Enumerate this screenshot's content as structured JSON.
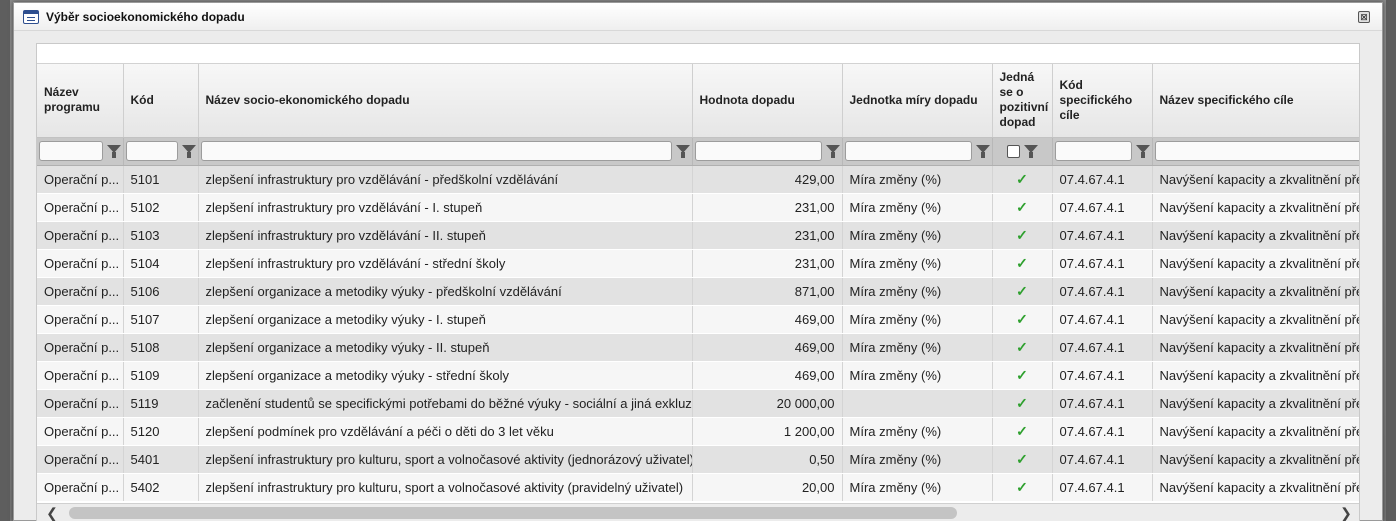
{
  "dialog": {
    "title": "Výběr socioekonomického dopadu",
    "close_glyph": "⊠"
  },
  "table": {
    "columns": [
      {
        "label": "Název programu"
      },
      {
        "label": "Kód"
      },
      {
        "label": "Název socio-ekonomického dopadu"
      },
      {
        "label": "Hodnota dopadu"
      },
      {
        "label": "Jednotka míry dopadu"
      },
      {
        "label": "Jedná se o pozitivní dopad"
      },
      {
        "label": "Kód specifického cíle"
      },
      {
        "label": "Název specifického cíle"
      }
    ],
    "rows": [
      {
        "program": "Operační p...",
        "kod": "5101",
        "nazev": "zlepšení infrastruktury pro vzdělávání - předškolní vzdělávání",
        "hodnota": "429,00",
        "jednotka": "Míra změny (%)",
        "pozitivni": true,
        "kod_cile": "07.4.67.4.1",
        "nazev_cile": "Navýšení kapacity a zkvalitnění předš"
      },
      {
        "program": "Operační p...",
        "kod": "5102",
        "nazev": "zlepšení infrastruktury pro vzdělávání - I. stupeň",
        "hodnota": "231,00",
        "jednotka": "Míra změny (%)",
        "pozitivni": true,
        "kod_cile": "07.4.67.4.1",
        "nazev_cile": "Navýšení kapacity a zkvalitnění předš"
      },
      {
        "program": "Operační p...",
        "kod": "5103",
        "nazev": "zlepšení infrastruktury pro vzdělávání - II. stupeň",
        "hodnota": "231,00",
        "jednotka": "Míra změny (%)",
        "pozitivni": true,
        "kod_cile": "07.4.67.4.1",
        "nazev_cile": "Navýšení kapacity a zkvalitnění předš"
      },
      {
        "program": "Operační p...",
        "kod": "5104",
        "nazev": "zlepšení infrastruktury pro vzdělávání - střední školy",
        "hodnota": "231,00",
        "jednotka": "Míra změny (%)",
        "pozitivni": true,
        "kod_cile": "07.4.67.4.1",
        "nazev_cile": "Navýšení kapacity a zkvalitnění předš"
      },
      {
        "program": "Operační p...",
        "kod": "5106",
        "nazev": "zlepšení organizace a metodiky výuky - předškolní vzdělávání",
        "hodnota": "871,00",
        "jednotka": "Míra změny (%)",
        "pozitivni": true,
        "kod_cile": "07.4.67.4.1",
        "nazev_cile": "Navýšení kapacity a zkvalitnění předš"
      },
      {
        "program": "Operační p...",
        "kod": "5107",
        "nazev": "zlepšení organizace a metodiky výuky - I. stupeň",
        "hodnota": "469,00",
        "jednotka": "Míra změny (%)",
        "pozitivni": true,
        "kod_cile": "07.4.67.4.1",
        "nazev_cile": "Navýšení kapacity a zkvalitnění předš"
      },
      {
        "program": "Operační p...",
        "kod": "5108",
        "nazev": "zlepšení organizace a metodiky výuky - II. stupeň",
        "hodnota": "469,00",
        "jednotka": "Míra změny (%)",
        "pozitivni": true,
        "kod_cile": "07.4.67.4.1",
        "nazev_cile": "Navýšení kapacity a zkvalitnění předš"
      },
      {
        "program": "Operační p...",
        "kod": "5109",
        "nazev": "zlepšení organizace a metodiky výuky - střední školy",
        "hodnota": "469,00",
        "jednotka": "Míra změny (%)",
        "pozitivni": true,
        "kod_cile": "07.4.67.4.1",
        "nazev_cile": "Navýšení kapacity a zkvalitnění předš"
      },
      {
        "program": "Operační p...",
        "kod": "5119",
        "nazev": "začlenění studentů se specifickými potřebami do běžné výuky - sociální a jiná exkluze",
        "hodnota": "20 000,00",
        "jednotka": "",
        "pozitivni": true,
        "kod_cile": "07.4.67.4.1",
        "nazev_cile": "Navýšení kapacity a zkvalitnění předš"
      },
      {
        "program": "Operační p...",
        "kod": "5120",
        "nazev": "zlepšení podmínek pro vzdělávání a péči o děti do 3 let věku",
        "hodnota": "1 200,00",
        "jednotka": "Míra změny (%)",
        "pozitivni": true,
        "kod_cile": "07.4.67.4.1",
        "nazev_cile": "Navýšení kapacity a zkvalitnění předš"
      },
      {
        "program": "Operační p...",
        "kod": "5401",
        "nazev": "zlepšení infrastruktury pro kulturu, sport a volnočasové aktivity (jednorázový uživatel)",
        "hodnota": "0,50",
        "jednotka": "Míra změny (%)",
        "pozitivni": true,
        "kod_cile": "07.4.67.4.1",
        "nazev_cile": "Navýšení kapacity a zkvalitnění předš"
      },
      {
        "program": "Operační p...",
        "kod": "5402",
        "nazev": "zlepšení infrastruktury pro kulturu, sport a volnočasové aktivity (pravidelný uživatel)",
        "hodnota": "20,00",
        "jednotka": "Míra změny (%)",
        "pozitivni": true,
        "kod_cile": "07.4.67.4.1",
        "nazev_cile": "Navýšení kapacity a zkvalitnění předš"
      }
    ],
    "check_glyph": "✓"
  },
  "scrollbar": {
    "left_glyph": "❮",
    "right_glyph": "❯"
  },
  "icons": {
    "dialog_icon": "list-window-icon",
    "filter_icon": "funnel-icon",
    "check_icon": "checkmark-icon"
  },
  "colors": {
    "check": "#2ea02e",
    "row_odd": "#e2e2e2",
    "row_even": "#f6f6f6",
    "filter_row": "#c8c8c8"
  }
}
